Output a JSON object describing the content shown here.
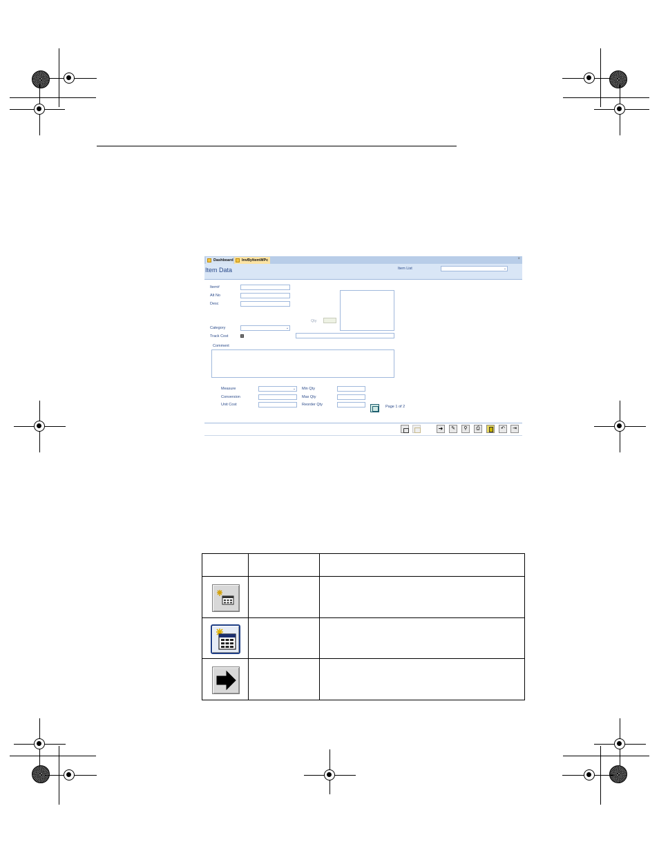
{
  "form": {
    "tabs": [
      {
        "label": "Dashboard"
      },
      {
        "label": "InvByItemWPc"
      }
    ],
    "title": "Item Data",
    "item_list_label": "Item List",
    "labels": {
      "item": "Item#",
      "alt_no": "Alt No",
      "desc": "Desc",
      "category": "Category",
      "track_cost": "Track Cost",
      "qty": "Qty",
      "comment": "Comment",
      "measure": "Measure",
      "conversion": "Conversion",
      "unit_cost": "Unit Cost",
      "min_qty": "Min Qty",
      "max_qty": "Max Qty",
      "reorder_qty": "Reorder Qty"
    },
    "page_indicator": "Page 1 of 2"
  },
  "icons": {
    "new_record": "new-record-icon",
    "datasheet": "new-datasheet-icon",
    "next": "arrow-right-icon"
  }
}
